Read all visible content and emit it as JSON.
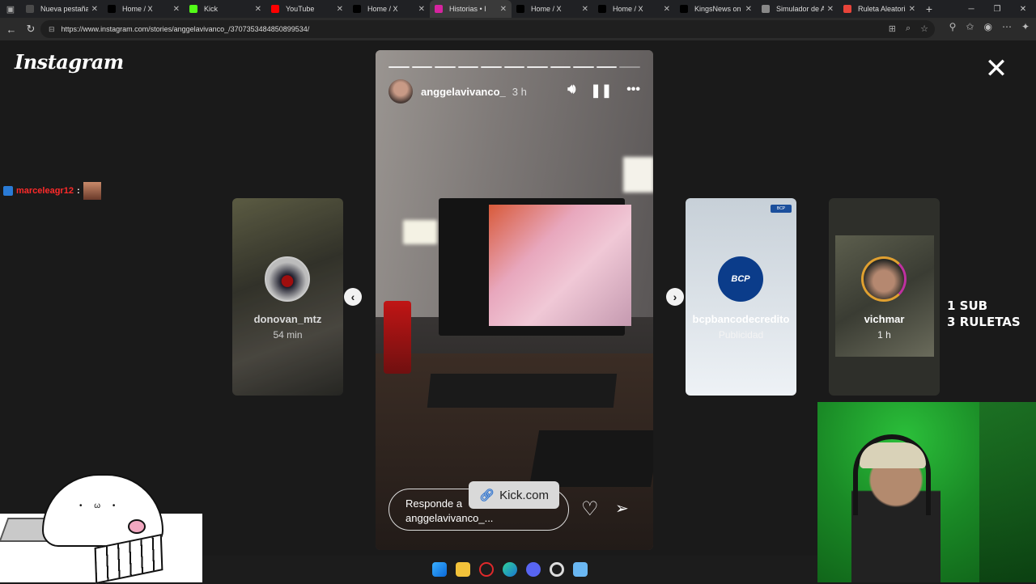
{
  "browser": {
    "tabs": [
      {
        "title": "Nueva pestaña",
        "favicon": "new-tab",
        "color": "#4a4a4a"
      },
      {
        "title": "Home / X",
        "favicon": "x-logo",
        "color": "#000000"
      },
      {
        "title": "Kick",
        "favicon": "kick-logo",
        "color": "#53fc18"
      },
      {
        "title": "YouTube",
        "favicon": "youtube-logo",
        "color": "#ff0000"
      },
      {
        "title": "Home / X",
        "favicon": "x-logo",
        "color": "#000000"
      },
      {
        "title": "Historias • I",
        "favicon": "instagram-logo",
        "color": "#d6249f",
        "active": true
      },
      {
        "title": "Home / X",
        "favicon": "x-logo",
        "color": "#000000"
      },
      {
        "title": "Home / X",
        "favicon": "x-logo",
        "color": "#000000"
      },
      {
        "title": "KingsNews on X",
        "favicon": "x-logo",
        "color": "#000000"
      },
      {
        "title": "Simulador de Al",
        "favicon": "globe",
        "color": "#888888"
      },
      {
        "title": "Ruleta Aleatoria",
        "favicon": "wheel",
        "color": "#e8443a"
      }
    ],
    "url": "https://www.instagram.com/stories/anggelavivanco_/3707353484850899534/"
  },
  "instagram": {
    "logo": "Instagram",
    "chat_overlay": {
      "user": "marceleagr12",
      "separator": ":"
    },
    "left_story": {
      "name": "donovan_mtz",
      "time": "54 min"
    },
    "main_story": {
      "username": "anggelavivanco_",
      "time": "3 h",
      "reply_placeholder_line1": "Responde a",
      "reply_placeholder_line2": "anggelavivanco_...",
      "progress_segments": 11,
      "progress_current": 10
    },
    "right_stories": [
      {
        "name": "bcpbancodecredito",
        "sub": "Publicidad",
        "logo": "BCP"
      },
      {
        "name": "vichmar",
        "sub": "1 h"
      }
    ]
  },
  "stream_overlay": {
    "kick_badge": "Kick.com",
    "promo_line1": "1 SUB",
    "promo_line2": "3 RULETAS"
  },
  "colors": {
    "chat_user": "#ff2a2a",
    "bcp_blue": "#0b3c8a",
    "page_bg": "#1a1a1a"
  }
}
